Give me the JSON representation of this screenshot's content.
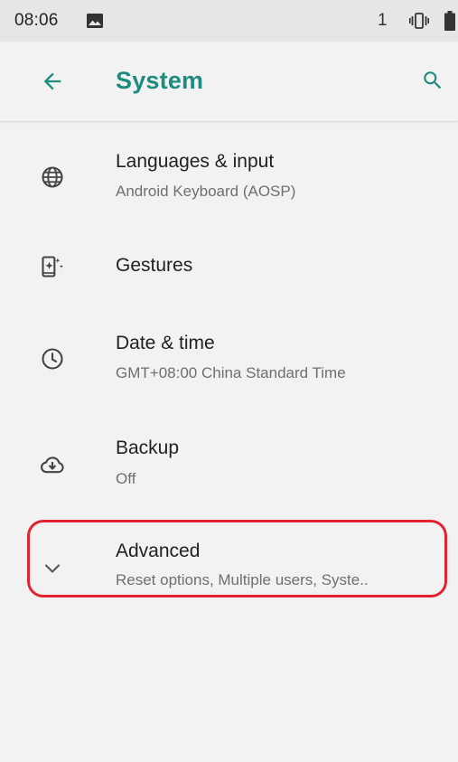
{
  "status_bar": {
    "time": "08:06",
    "sim_label": "1",
    "icons": [
      "image-icon",
      "vibrate-icon",
      "battery-icon"
    ]
  },
  "app_bar": {
    "title": "System",
    "back_icon": "arrow-back-icon",
    "search_icon": "search-icon"
  },
  "colors": {
    "accent": "#1e8c7e",
    "background": "#f2f2f2",
    "status_bar": "#e6e6e6",
    "highlight": "#e0232f"
  },
  "items": [
    {
      "title": "Languages & input",
      "summary": "Android Keyboard (AOSP)",
      "icon": "globe-icon"
    },
    {
      "title": "Gestures",
      "summary": "",
      "icon": "gestures-phone-icon"
    },
    {
      "title": "Date & time",
      "summary": "GMT+08:00 China Standard Time",
      "icon": "clock-icon"
    },
    {
      "title": "Backup",
      "summary": "Off",
      "icon": "cloud-backup-icon"
    },
    {
      "title": "Advanced",
      "summary": "Reset options, Multiple users, Syste..",
      "icon": "chevron-down-icon",
      "highlighted": true
    }
  ]
}
